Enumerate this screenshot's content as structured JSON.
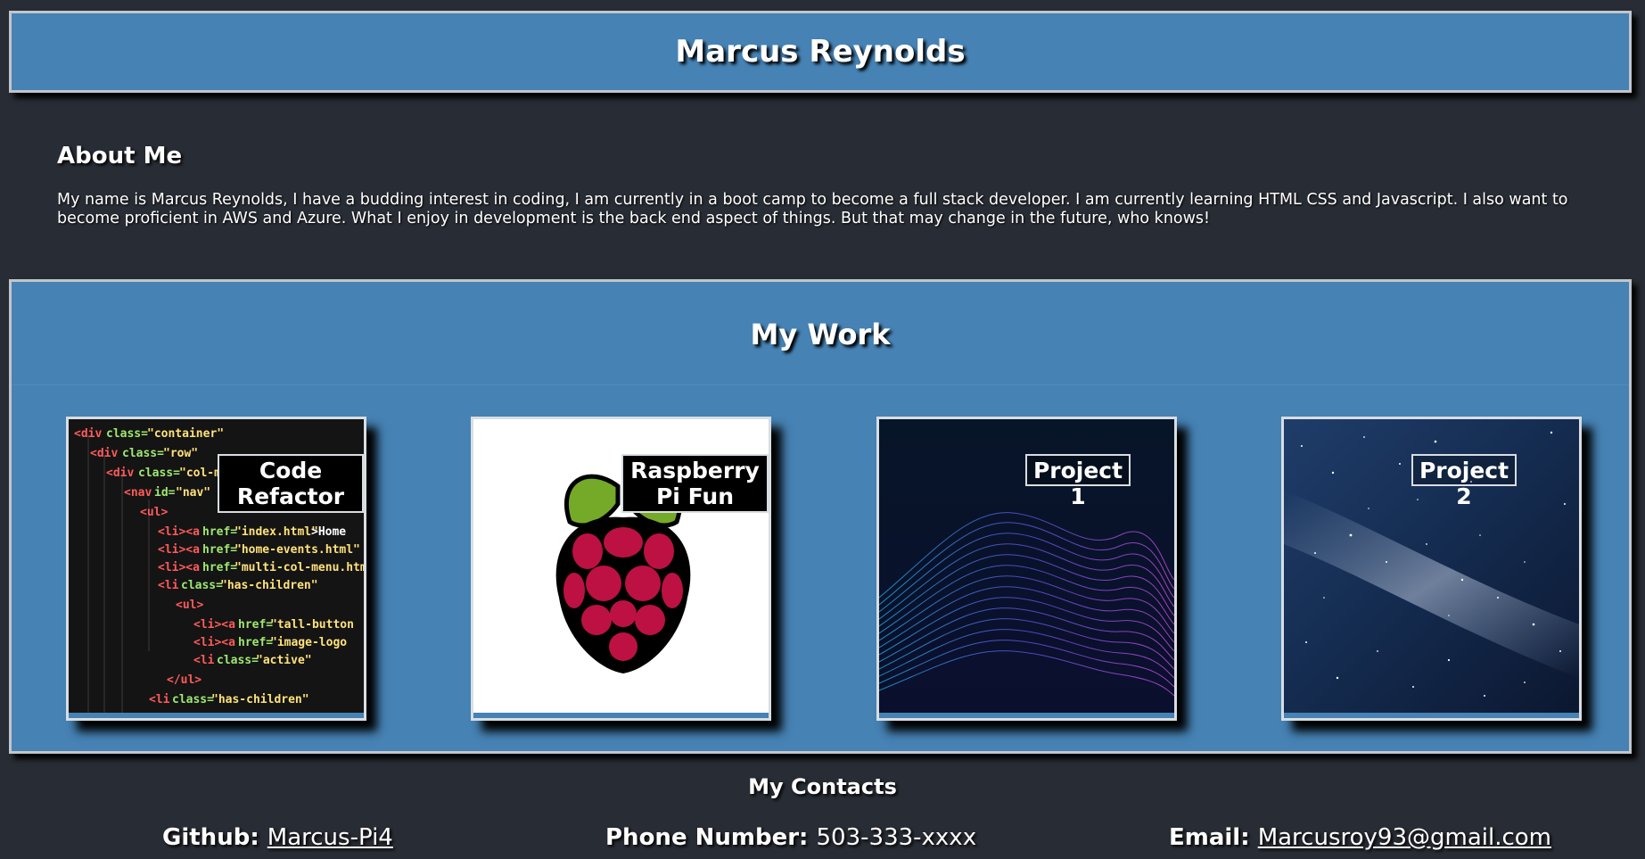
{
  "header": {
    "title": "Marcus Reynolds"
  },
  "about": {
    "heading": "About Me",
    "text": "My name is Marcus Reynolds, I have a budding interest in coding, I am currently in a boot camp to become a full stack developer. I am currently learning HTML CSS and Javascript. I also want to become proficient in AWS and Azure. What I enjoy in development is the back end aspect of things. But that may change in the future, who knows!"
  },
  "work": {
    "heading": "My Work",
    "projects": [
      {
        "label": "Code Refactor",
        "image": "code-screenshot"
      },
      {
        "label": "Raspberry Pi Fun",
        "image": "raspberry-pi-logo"
      },
      {
        "label": "Project 1",
        "image": "abstract-waves"
      },
      {
        "label": "Project 2",
        "image": "starry-sky"
      }
    ]
  },
  "contacts": {
    "heading": "My Contacts",
    "github_label": "Github:",
    "github_value": "Marcus-Pi4",
    "phone_label": "Phone Number:",
    "phone_value": "503-333-xxxx",
    "email_label": "Email:",
    "email_value": "Marcusroy93@gmail.com"
  },
  "colors": {
    "background": "#282c34",
    "accent": "#4682b4",
    "border": "#c0c6cc"
  }
}
